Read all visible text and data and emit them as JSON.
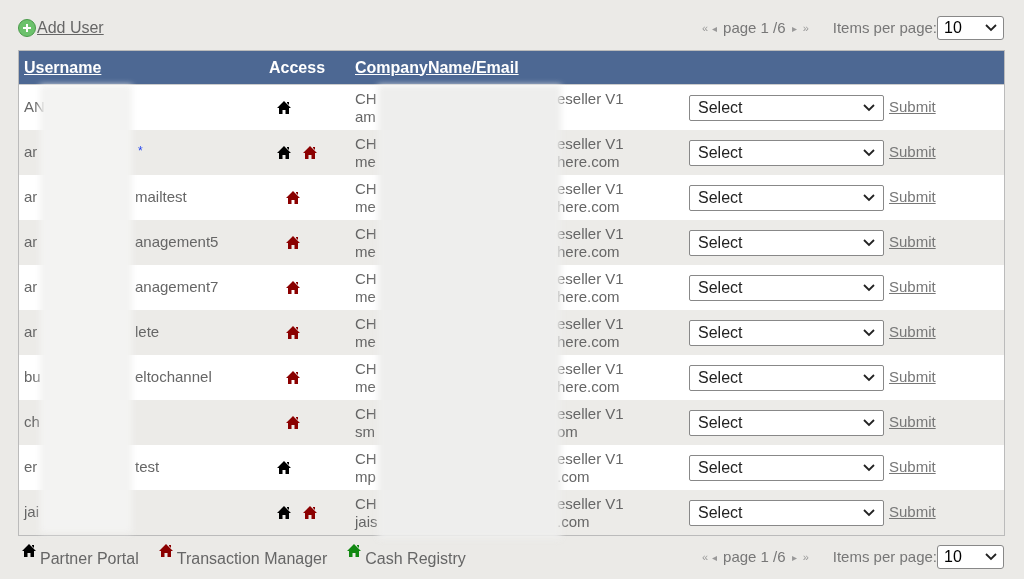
{
  "toolbar": {
    "add_user": "Add User",
    "pager": {
      "first": "«",
      "previous": "◂",
      "page": "page 1 /6",
      "next": "▸",
      "last": "»",
      "items_label": "Items per page:",
      "items_value": "10"
    }
  },
  "table": {
    "columns": [
      {
        "label": "Username",
        "sortable": true
      },
      {
        "label": "Access",
        "sortable": false
      },
      {
        "label": "CompanyName/Email",
        "sortable": true
      }
    ],
    "rows": [
      {
        "username_start": "AN",
        "partner_portal": true,
        "transaction_manager": false,
        "company_start": "CH",
        "company_end": "eseller V1",
        "email_start": "am",
        "action": "Select",
        "submit": "Submit"
      },
      {
        "username_start": "ar",
        "flag": "*",
        "partner_portal": true,
        "transaction_manager": true,
        "company_start": "CH",
        "company_end": "eseller V1",
        "email_start": "me",
        "email_end": "here.com",
        "action": "Select",
        "submit": "Submit"
      },
      {
        "username_start": "ar",
        "username_end": "mailtest",
        "partner_portal": false,
        "transaction_manager": true,
        "company_start": "CH",
        "company_end": "eseller V1",
        "email_start": "me",
        "email_end": "here.com",
        "action": "Select",
        "submit": "Submit"
      },
      {
        "username_start": "ar",
        "username_end": "anagement5",
        "partner_portal": false,
        "transaction_manager": true,
        "company_start": "CH",
        "company_end": "eseller V1",
        "email_start": "me",
        "email_end": "here.com",
        "action": "Select",
        "submit": "Submit"
      },
      {
        "username_start": "ar",
        "username_end": "anagement7",
        "partner_portal": false,
        "transaction_manager": true,
        "company_start": "CH",
        "company_end": "eseller V1",
        "email_start": "me",
        "email_end": "here.com",
        "action": "Select",
        "submit": "Submit"
      },
      {
        "username_start": "ar",
        "username_end": "lete",
        "partner_portal": false,
        "transaction_manager": true,
        "company_start": "CH",
        "company_end": "eseller V1",
        "email_start": "me",
        "email_end": "here.com",
        "action": "Select",
        "submit": "Submit"
      },
      {
        "username_start": "bu",
        "username_end": "eltochannel",
        "partner_portal": false,
        "transaction_manager": true,
        "company_start": "CH",
        "company_end": "eseller V1",
        "email_start": "me",
        "email_end": "here.com",
        "action": "Select",
        "submit": "Submit"
      },
      {
        "username_start": "ch",
        "partner_portal": false,
        "transaction_manager": true,
        "company_start": "CH",
        "company_end": "eseller V1",
        "email_start": "sm",
        "email_end": "om",
        "action": "Select",
        "submit": "Submit"
      },
      {
        "username_start": "er",
        "username_end": "test",
        "partner_portal": true,
        "transaction_manager": false,
        "company_start": "CH",
        "company_end": "eseller V1",
        "email_start": "mp",
        "email_end": ".com",
        "action": "Select",
        "submit": "Submit"
      },
      {
        "username_start": "jai",
        "partner_portal": true,
        "transaction_manager": true,
        "company_start": "CH",
        "company_end": "eseller V1",
        "email_start": "jais",
        "email_end": ".com",
        "action": "Select",
        "submit": "Submit"
      }
    ]
  },
  "legend": [
    {
      "label": "Partner Portal",
      "color": "#000000"
    },
    {
      "label": "Transaction Manager",
      "color": "#8b0000"
    },
    {
      "label": "Cash Registry",
      "color": "#118811"
    }
  ],
  "footer_pager": {
    "first": "«",
    "previous": "◂",
    "page": "page 1 /6",
    "next": "▸",
    "last": "»",
    "items_label": "Items per page:",
    "items_value": "10"
  }
}
